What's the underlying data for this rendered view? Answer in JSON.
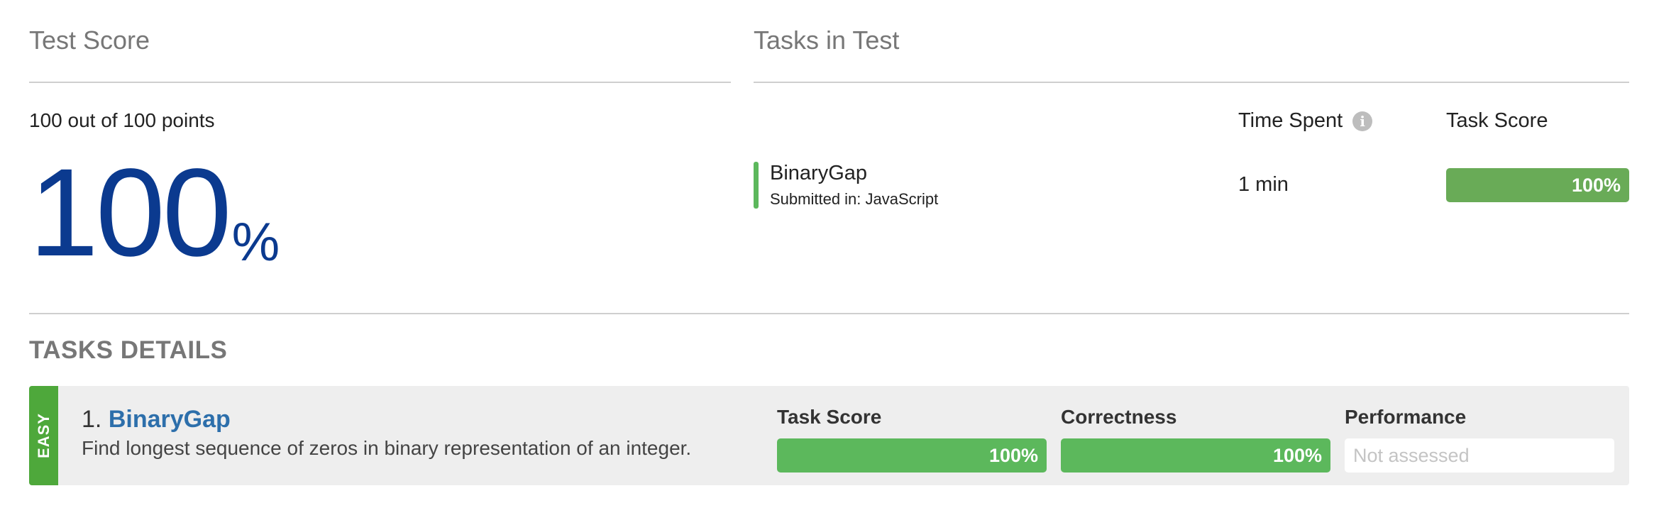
{
  "test_score": {
    "title": "Test Score",
    "points_text": "100 out of 100 points",
    "percent_value": "100",
    "percent_sign": "%"
  },
  "tasks_in_test": {
    "title": "Tasks in Test",
    "columns": {
      "time_spent": "Time Spent",
      "task_score": "Task Score"
    },
    "info_icon": "info-icon",
    "tasks": [
      {
        "name": "BinaryGap",
        "submitted_in": "Submitted in: JavaScript",
        "time_spent": "1 min",
        "score_label": "100%",
        "score_fraction": 1.0
      }
    ]
  },
  "tasks_details": {
    "title": "TASKS DETAILS",
    "items": [
      {
        "difficulty": "EASY",
        "number": "1.",
        "name": "BinaryGap",
        "description": "Find longest sequence of zeros in binary representation of an integer.",
        "task_score_label": "Task Score",
        "task_score": "100%",
        "correctness_label": "Correctness",
        "correctness": "100%",
        "performance_label": "Performance",
        "performance": "Not assessed"
      }
    ]
  },
  "colors": {
    "score_blue": "#0b3a8f",
    "success_green": "#5cb85c",
    "easy_green": "#4ea83b",
    "link_blue": "#2d6fab"
  }
}
